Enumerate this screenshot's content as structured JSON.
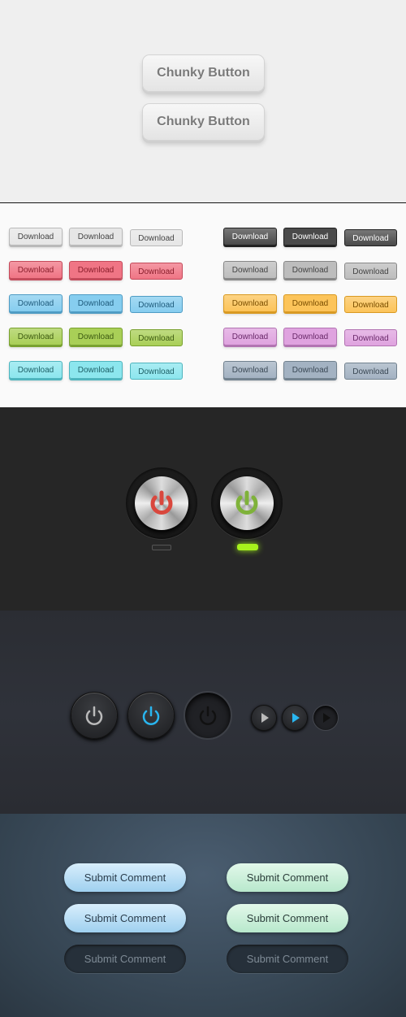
{
  "chunky": {
    "buttons": [
      "Chunky Button",
      "Chunky Button"
    ]
  },
  "download": {
    "label": "Download",
    "left_rows": [
      {
        "color": "gray",
        "bg": "#e6e6e6",
        "edge": "#b9b9b9",
        "text": "#444"
      },
      {
        "color": "red",
        "bg": "#f07585",
        "edge": "#c44b5b",
        "text": "#8b1e2c"
      },
      {
        "color": "blue",
        "bg": "#86cdef",
        "edge": "#4f9cc4",
        "text": "#1f5b7c"
      },
      {
        "color": "green",
        "bg": "#a9cf57",
        "edge": "#79a130",
        "text": "#3d5a12"
      },
      {
        "color": "cyan",
        "bg": "#8ce6ee",
        "edge": "#4fb5be",
        "text": "#1d6067"
      }
    ],
    "right_rows": [
      {
        "color": "dark",
        "bg": "#4a4a4a",
        "edge": "#222",
        "text": "#fff"
      },
      {
        "color": "gray",
        "bg": "#bdbdbd",
        "edge": "#888",
        "text": "#444"
      },
      {
        "color": "orange",
        "bg": "#fcc45a",
        "edge": "#d99a23",
        "text": "#7a4e00"
      },
      {
        "color": "pink",
        "bg": "#dfa3df",
        "edge": "#b274b2",
        "text": "#6a2a6a"
      },
      {
        "color": "slate",
        "bg": "#a3b2c2",
        "edge": "#72828f",
        "text": "#3a4855"
      }
    ]
  },
  "power_metal": [
    {
      "state": "off",
      "accent": "#d9473d"
    },
    {
      "state": "on",
      "accent": "#7fb23a"
    }
  ],
  "dark_controls": {
    "accent": "#29b6f0"
  },
  "submit": {
    "label": "Submit Comment",
    "rows": [
      [
        "blue",
        "green"
      ],
      [
        "blue",
        "green"
      ],
      [
        "dark",
        "dark"
      ]
    ]
  }
}
